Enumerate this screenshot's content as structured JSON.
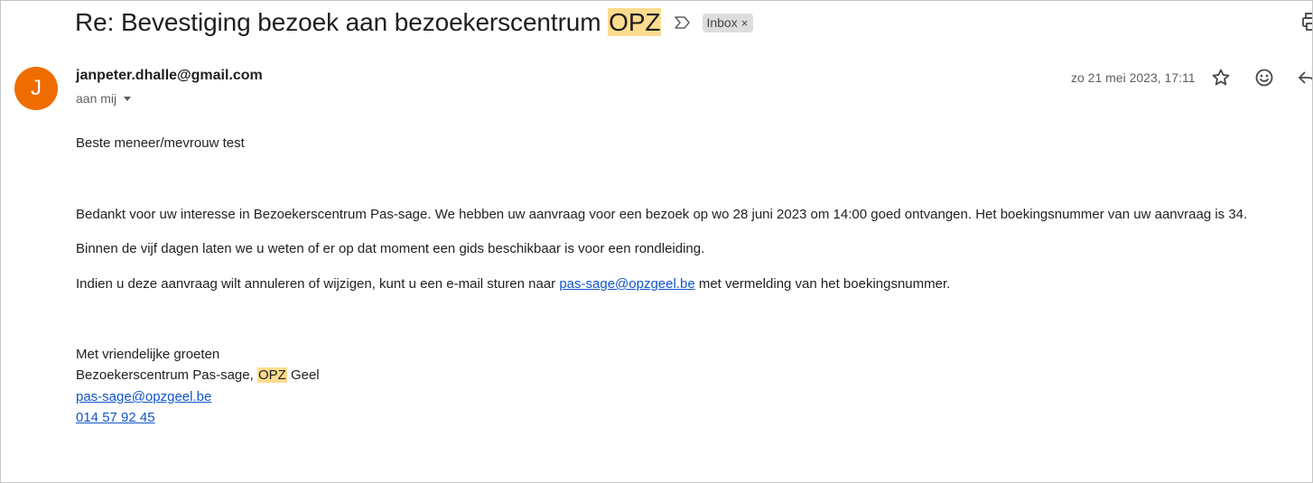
{
  "subject": {
    "before": "Re: Bevestiging bezoek aan bezoekerscentrum ",
    "highlight": "OPZ"
  },
  "label_chip": {
    "text": "Inbox",
    "remove": "×"
  },
  "icons": {
    "important": "important-marker-icon",
    "print": "print-icon",
    "star": "star-icon",
    "emoji": "emoji-reaction-icon",
    "reply": "reply-icon"
  },
  "sender": {
    "avatar_letter": "J",
    "avatar_color": "#ef6c00",
    "email": "janpeter.dhalle@gmail.com",
    "to": "aan mij"
  },
  "date": "zo 21 mei 2023, 17:11",
  "body": {
    "greeting": "Beste meneer/mevrouw test",
    "p1": "Bedankt voor uw interesse in Bezoekerscentrum Pas-sage. We hebben uw aanvraag voor een bezoek op wo 28 juni 2023 om 14:00 goed ontvangen. Het boekingsnummer van uw aanvraag is 34.",
    "p2": "Binnen de vijf dagen laten we u weten of er op dat moment een gids beschikbaar is voor een rondleiding.",
    "p3_before": "Indien u deze aanvraag wilt annuleren of wijzigen, kunt u een e-mail sturen naar ",
    "p3_link": "pas-sage@opzgeel.be",
    "p3_after": " met vermelding van het boekingsnummer."
  },
  "signature": {
    "closing": "Met vriendelijke groeten",
    "org_before": "Bezoekerscentrum Pas-sage, ",
    "org_highlight": "OPZ",
    "org_after": " Geel",
    "email": "pas-sage@opzgeel.be",
    "phone": "014 57 92 45"
  },
  "colors": {
    "highlight": "#fddc8f",
    "link": "#1155cc",
    "chip_bg": "#dddddd"
  }
}
